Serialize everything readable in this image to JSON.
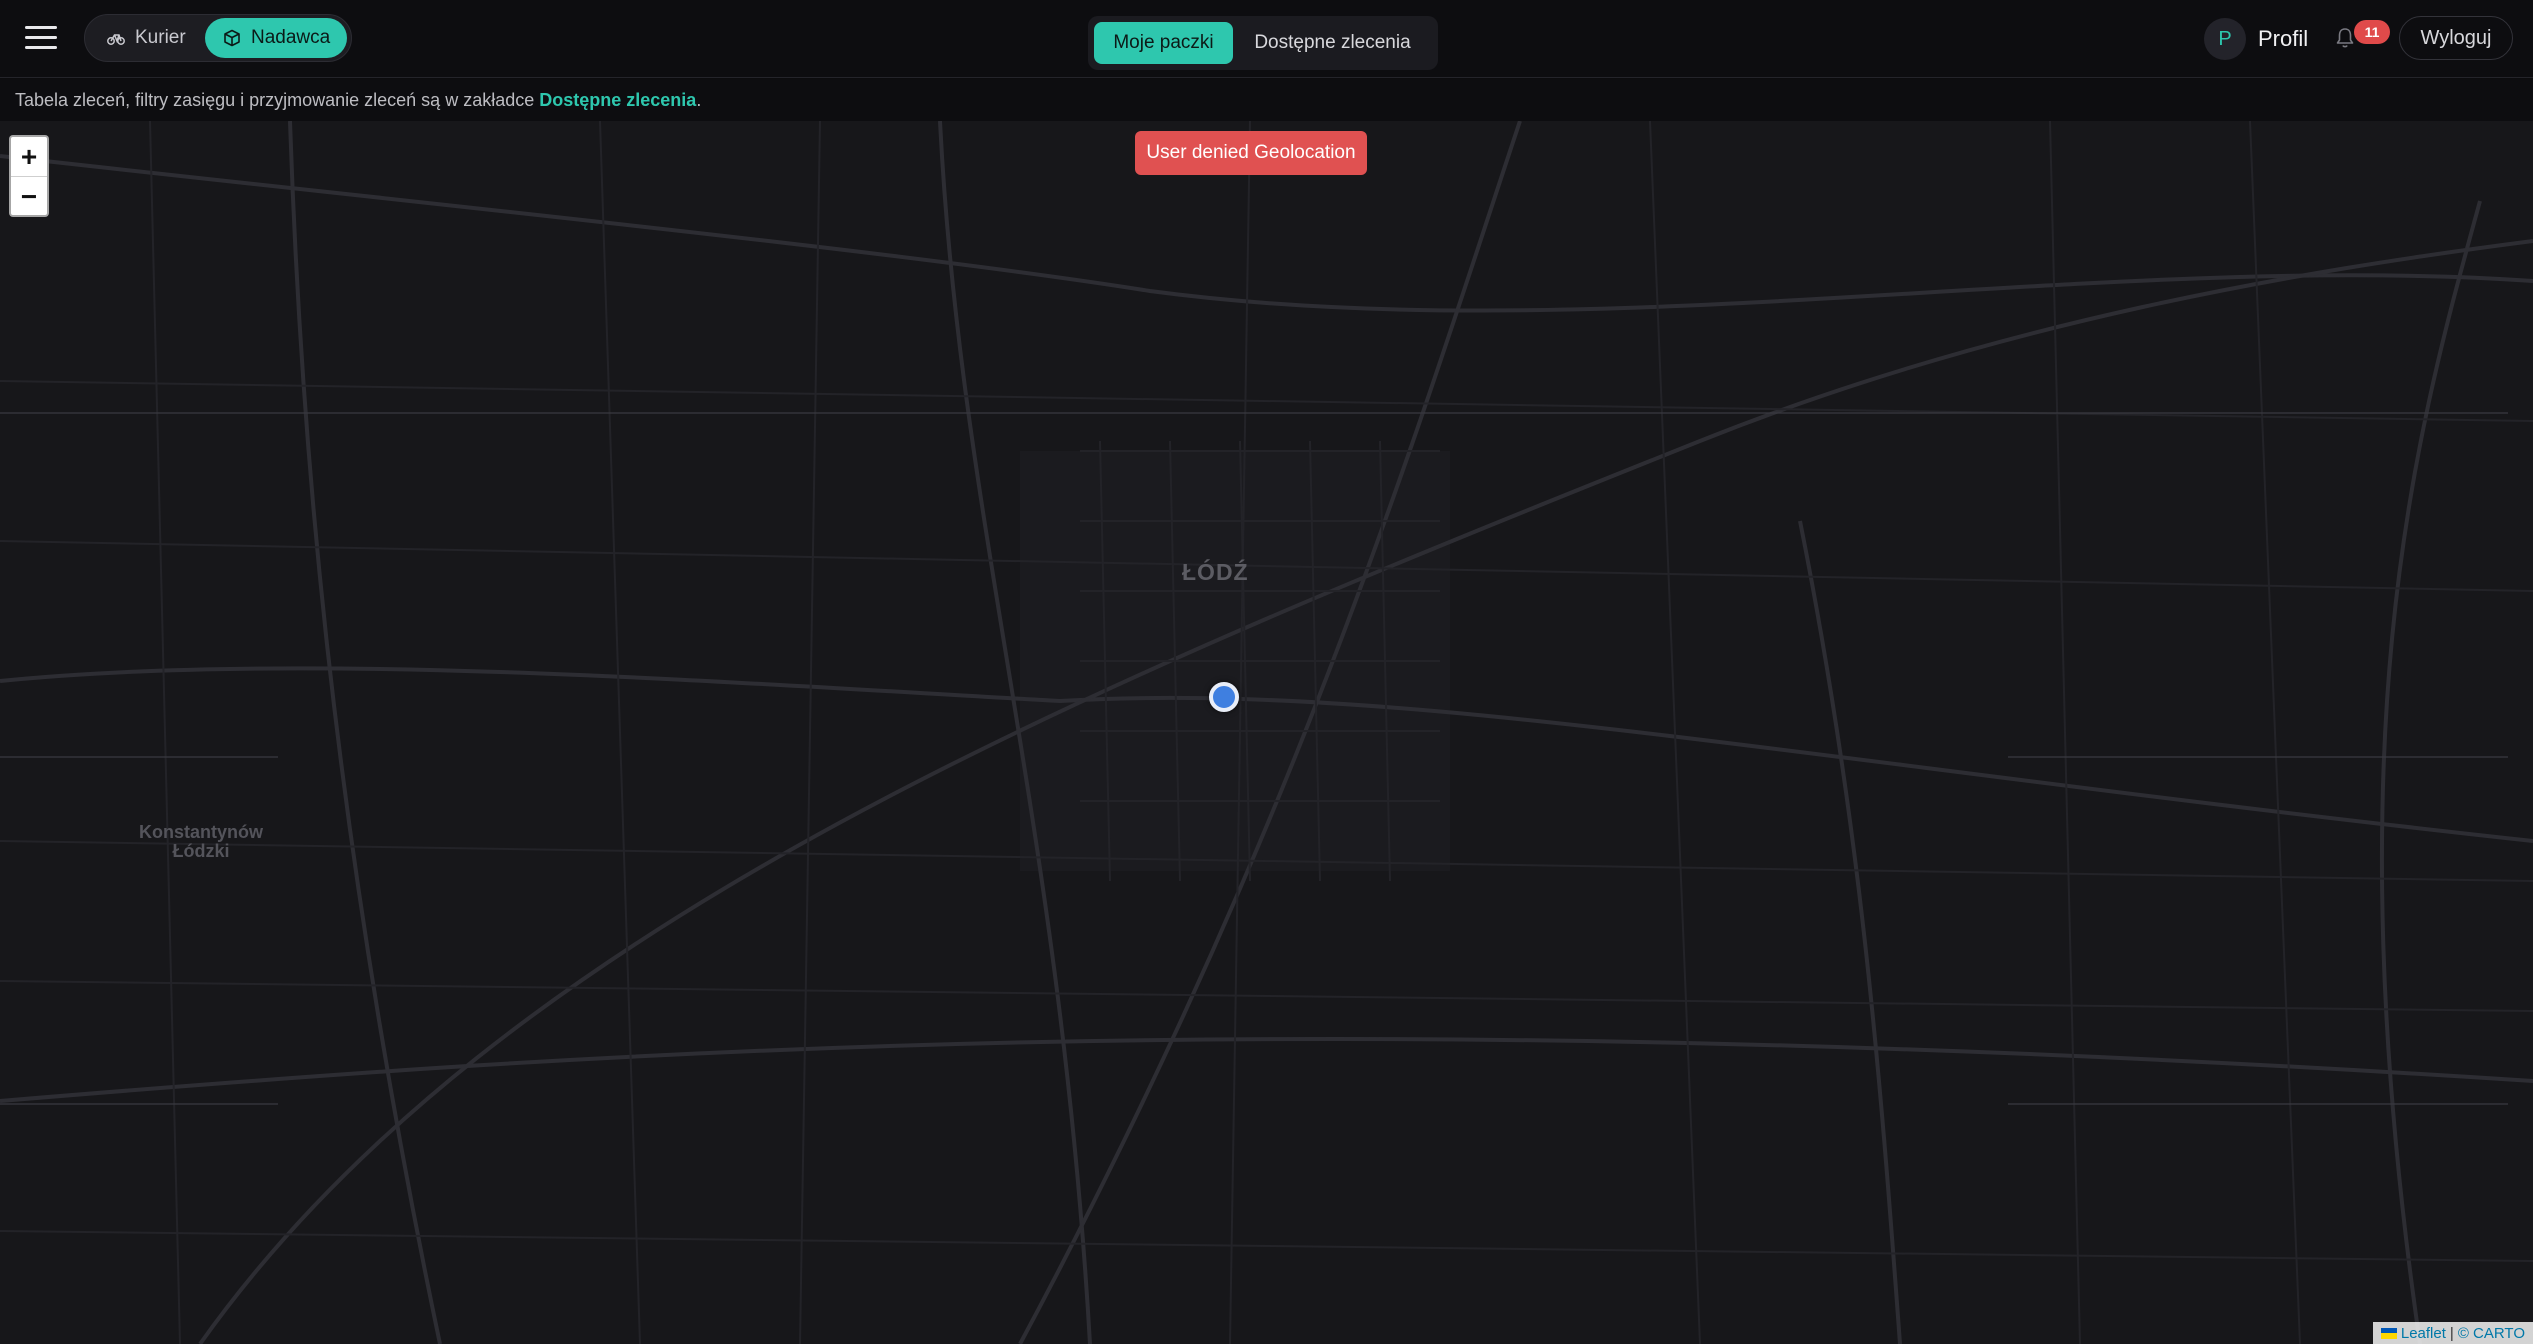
{
  "header": {
    "role_switch": {
      "courier_label": "Kurier",
      "sender_label": "Nadawca",
      "active": "Nadawca"
    },
    "tabs": [
      {
        "label": "Moje paczki",
        "active": true
      },
      {
        "label": "Dostępne zlecenia",
        "active": false
      }
    ],
    "profile": {
      "initial": "P",
      "label": "Profil"
    },
    "notifications": {
      "count": "11"
    },
    "logout_label": "Wyloguj"
  },
  "info": {
    "text": "Tabela zleceń, filtry zasięgu i przyjmowanie zleceń są w zakładce ",
    "link": "Dostępne zlecenia",
    "suffix": "."
  },
  "map": {
    "zoom_in": "+",
    "zoom_out": "−",
    "geo_error": "User denied Geolocation",
    "city_label": "ŁÓDŹ",
    "town_label": "Konstantynów Łódzki",
    "attribution": {
      "leaflet": "Leaflet",
      "separator": "|",
      "carto": "© CARTO"
    }
  },
  "colors": {
    "accent": "#2ec7ae",
    "error": "#e05151",
    "badge": "#e04a4a",
    "marker": "#3f7fe0",
    "map_background": "#17171a"
  },
  "icons": {
    "menu": "hamburger-icon",
    "courier": "bicycle-icon",
    "sender": "package-icon",
    "notifications": "bell-icon"
  }
}
